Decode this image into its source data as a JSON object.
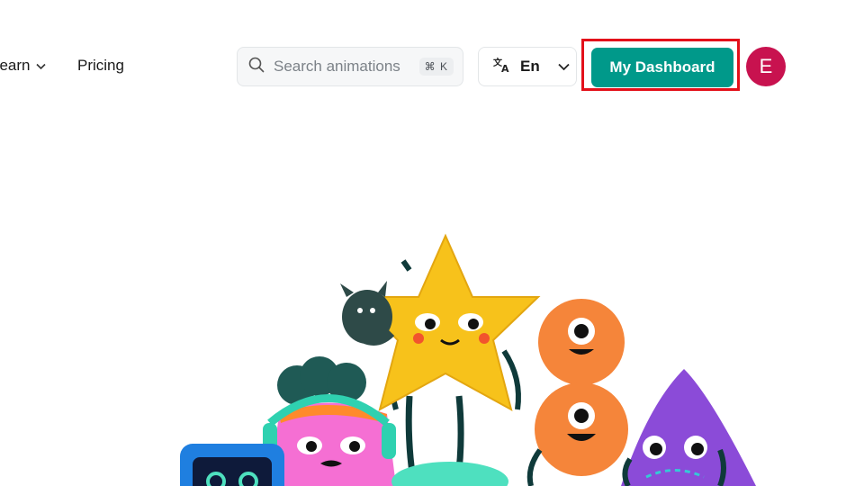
{
  "nav": {
    "learn_label": "Learn",
    "pricing_label": "Pricing"
  },
  "search": {
    "placeholder": "Search animations",
    "shortcut": "⌘ K"
  },
  "language": {
    "current": "En"
  },
  "dashboard_button": {
    "label": "My Dashboard"
  },
  "user": {
    "initial": "E",
    "avatar_color": "#c8124f"
  },
  "colors": {
    "accent": "#00998a",
    "highlight": "#e3101a"
  },
  "icons": [
    "chevron-down-icon",
    "search-icon",
    "translate-icon"
  ],
  "hero": {
    "illustration": "animated mascot characters"
  }
}
